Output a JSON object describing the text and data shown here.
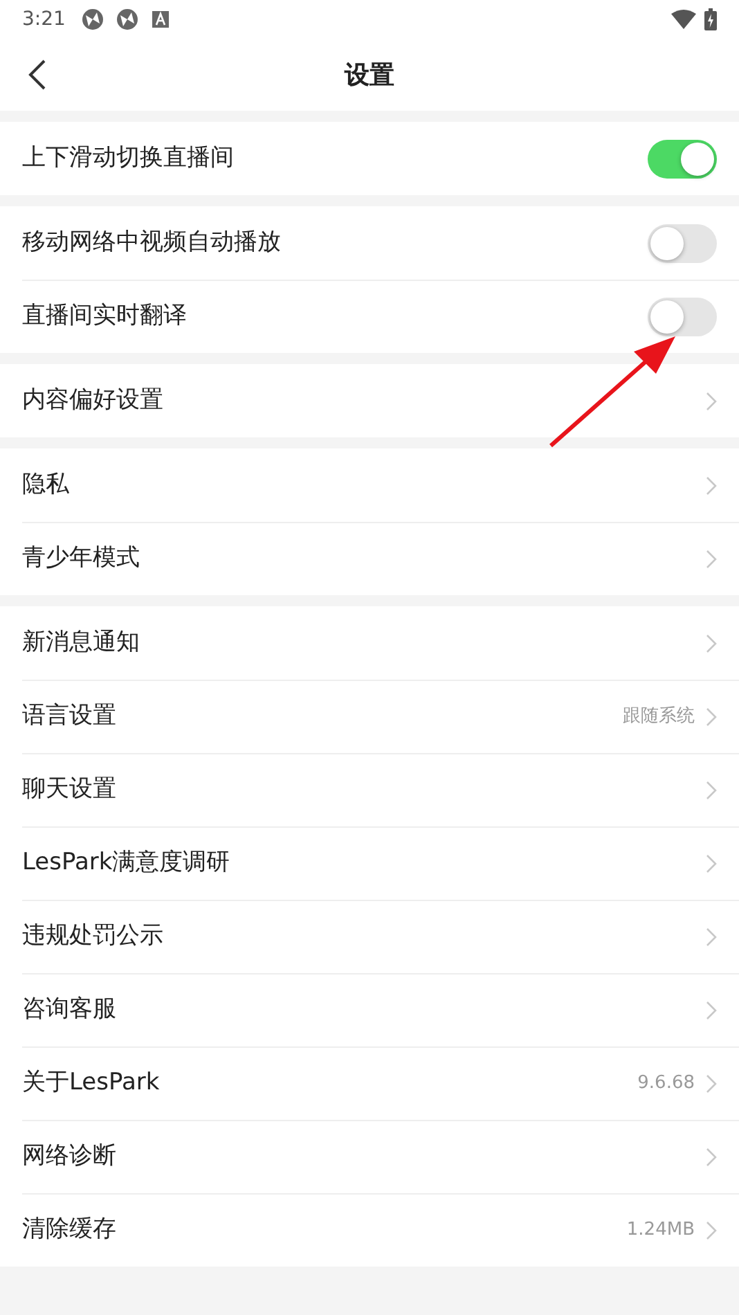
{
  "status_bar": {
    "time": "3:21"
  },
  "header": {
    "title": "设置"
  },
  "groups": [
    {
      "items": [
        {
          "kind": "toggle",
          "label": "上下滑动切换直播间",
          "on": true
        }
      ]
    },
    {
      "items": [
        {
          "kind": "toggle",
          "label": "移动网络中视频自动播放",
          "on": false
        },
        {
          "kind": "toggle",
          "label": "直播间实时翻译",
          "on": false
        }
      ]
    },
    {
      "items": [
        {
          "kind": "link",
          "label": "内容偏好设置"
        }
      ]
    },
    {
      "items": [
        {
          "kind": "link",
          "label": "隐私"
        },
        {
          "kind": "link",
          "label": "青少年模式"
        }
      ]
    },
    {
      "items": [
        {
          "kind": "link",
          "label": "新消息通知"
        },
        {
          "kind": "link",
          "label": "语言设置",
          "value": "跟随系统"
        },
        {
          "kind": "link",
          "label": "聊天设置"
        },
        {
          "kind": "link",
          "label": "LesPark满意度调研"
        },
        {
          "kind": "link",
          "label": "违规处罚公示"
        },
        {
          "kind": "link",
          "label": "咨询客服"
        },
        {
          "kind": "link",
          "label": "关于LesPark",
          "value": "9.6.68"
        },
        {
          "kind": "link",
          "label": "网络诊断"
        },
        {
          "kind": "link",
          "label": "清除缓存",
          "value": "1.24MB"
        }
      ]
    }
  ]
}
